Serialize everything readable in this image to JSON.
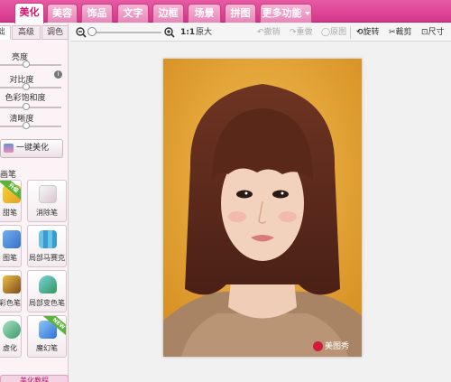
{
  "nav": {
    "tabs": [
      {
        "label": "美化",
        "active": true
      },
      {
        "label": "美容"
      },
      {
        "label": "饰品"
      },
      {
        "label": "文字"
      },
      {
        "label": "边框"
      },
      {
        "label": "场景"
      },
      {
        "label": "拼图"
      },
      {
        "label": "更多功能"
      }
    ]
  },
  "toolbar": {
    "zoom_ratio": "1:1",
    "original_size": "原大",
    "undo": "撤销",
    "redo": "重做",
    "original_image": "原图",
    "rotate": "旋转",
    "crop": "裁剪",
    "resize": "尺寸"
  },
  "panel": {
    "subtabs": [
      "础",
      "高级",
      "调色"
    ],
    "sliders": [
      {
        "label": "亮度",
        "value": 0.5
      },
      {
        "label": "对比度",
        "value": 0.5
      },
      {
        "label": "色彩饱和度",
        "value": 0.5
      },
      {
        "label": "清晰度",
        "value": 0.5
      }
    ],
    "one_click": "一键美化",
    "section_title": "画笔",
    "tools": [
      {
        "label": "甜笔",
        "badge": "升级"
      },
      {
        "label": "消除笔"
      },
      {
        "label": "图笔"
      },
      {
        "label": "局部马赛克"
      },
      {
        "label": "彩色笔"
      },
      {
        "label": "局部变色笔"
      },
      {
        "label": "虚化"
      },
      {
        "label": "魔幻笔",
        "badge": "NEW"
      }
    ],
    "bottom_button": "美化教程"
  },
  "photo": {
    "watermark": "美图秀"
  },
  "colors": {
    "nav_pink": "#d4368a",
    "active_tab_text": "#d4146e",
    "photo_background": "#e8a93a"
  }
}
